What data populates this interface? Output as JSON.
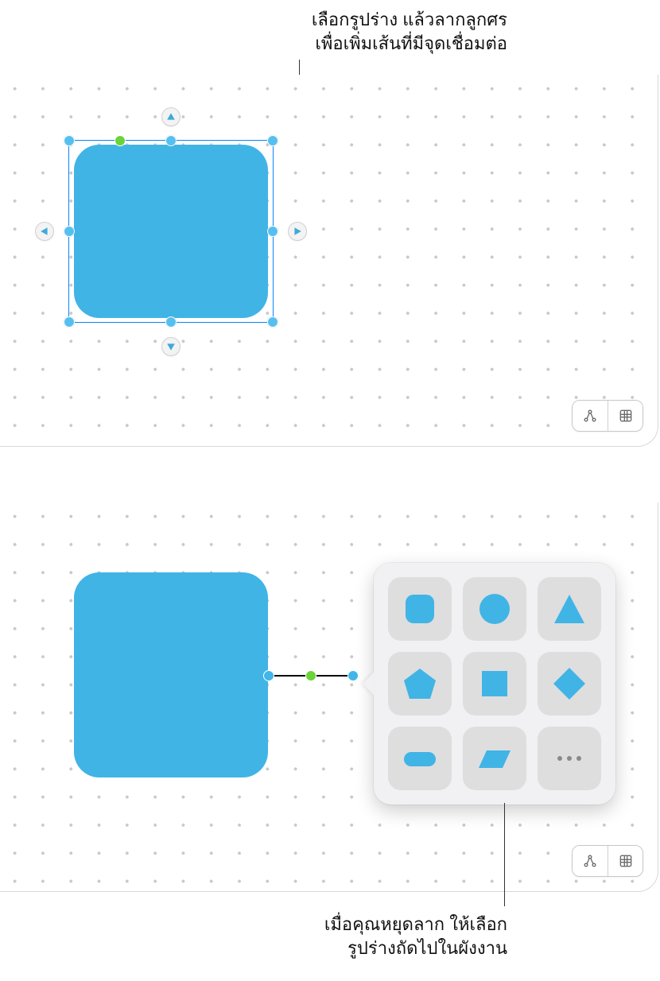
{
  "callouts": {
    "top": "เลือกรูปร่าง แล้วลากลูกศร\nเพื่อเพิ่มเส้นที่มีจุดเชื่อมต่อ",
    "bottom": "เมื่อคุณหยุดลาก ให้เลือก\nรูปร่างถัดไปในผังงาน"
  },
  "canvas_top": {
    "shape": {
      "type": "rounded-rect",
      "color": "#41b4e6"
    },
    "arrows": [
      "up",
      "down",
      "left",
      "right"
    ]
  },
  "canvas_bottom": {
    "shape": {
      "type": "rounded-rect",
      "color": "#41b4e6"
    },
    "connector": {
      "from": "shape-right",
      "to": "picker"
    }
  },
  "shape_picker": {
    "shapes": [
      "rounded-square",
      "circle",
      "triangle",
      "pentagon",
      "square",
      "diamond",
      "pill",
      "parallelogram",
      "more"
    ]
  },
  "toolbar": {
    "items": [
      "connection-tool",
      "grid-toggle"
    ]
  }
}
